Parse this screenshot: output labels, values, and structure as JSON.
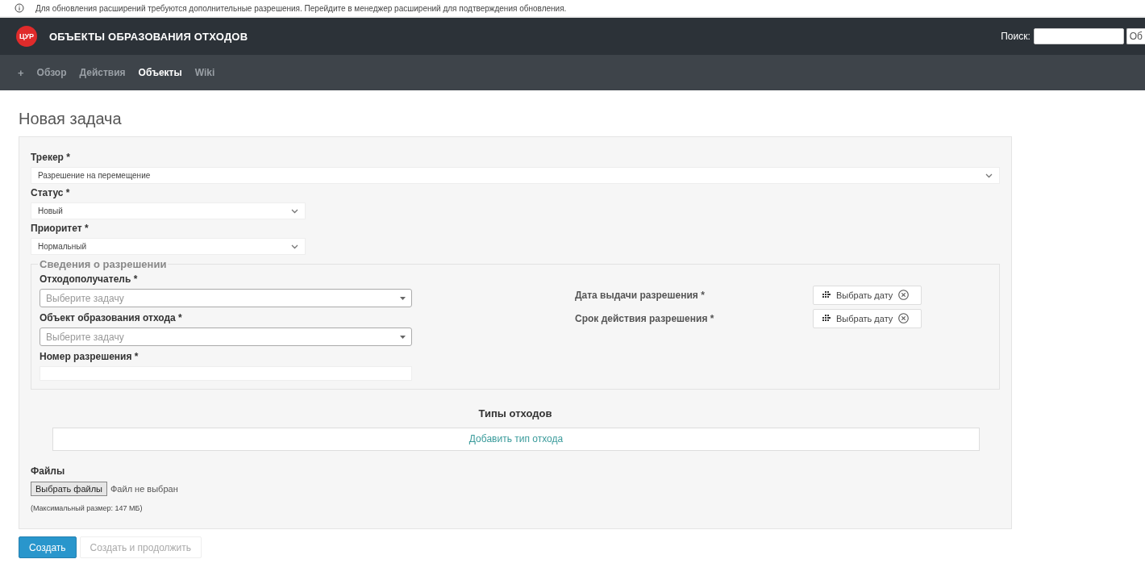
{
  "notice": {
    "text": "Для обновления расширений требуются дополнительные разрешения. Перейдите в менеджер расширений для подтверждения обновления."
  },
  "header": {
    "logo": "ЦУР",
    "title": "ОБЪЕКТЫ ОБРАЗОВАНИЯ ОТХОДОВ",
    "search_label": "Поиск:",
    "search_button": "Об"
  },
  "nav": {
    "new_button": "+",
    "items": [
      {
        "label": "Обзор",
        "selected": false
      },
      {
        "label": "Действия",
        "selected": false
      },
      {
        "label": "Объекты",
        "selected": true
      },
      {
        "label": "Wiki",
        "selected": false
      }
    ]
  },
  "page_title": "Новая задача",
  "form": {
    "fields": [
      {
        "label": "Трекер *",
        "value": "Разрешение на перемещение",
        "kind": "wide"
      },
      {
        "label": "Статус *",
        "value": "Новый",
        "kind": "narrow"
      },
      {
        "label": "Приоритет *",
        "value": "Нормальный",
        "kind": "narrow"
      }
    ],
    "fieldset": {
      "legend": "Сведения о разрешении",
      "left": [
        {
          "label": "Отходополучатель *",
          "kind": "select",
          "placeholder": "Выберите задачу"
        },
        {
          "label": "Объект образования отхода *",
          "kind": "select",
          "placeholder": "Выберите задачу"
        },
        {
          "label": "Номер разрешения *",
          "kind": "text"
        }
      ],
      "right": [
        {
          "label": "Дата выдачи разрешения *",
          "button": "Выбрать дату"
        },
        {
          "label": "Срок действия разрешения *",
          "button": "Выбрать дату"
        }
      ]
    },
    "waste_types": {
      "heading": "Типы отходов",
      "add_link": "Добавить тип отхода"
    },
    "files": {
      "label": "Файлы",
      "button": "Выбрать файлы",
      "status": "Файл не выбран",
      "hint": "(Максимальный размер: 147 МБ)"
    }
  },
  "actions": [
    {
      "label": "Создать",
      "kind": "primary"
    },
    {
      "label": "Создать и продолжить",
      "kind": "secondary"
    }
  ]
}
